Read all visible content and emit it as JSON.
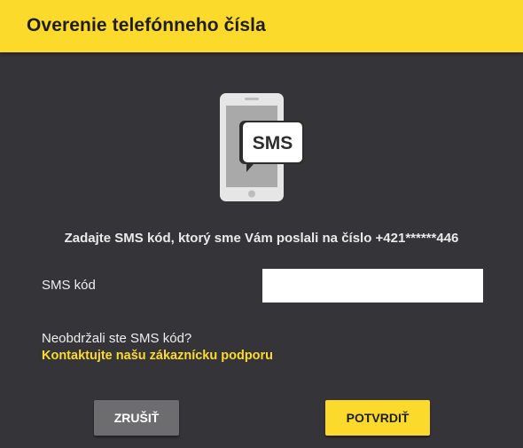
{
  "dialog": {
    "title": "Overenie telefónneho čísla",
    "illustration": {
      "icon": "phone-sms-icon",
      "bubble_text": "SMS"
    },
    "instruction": "Zadajte SMS kód, ktorý sme Vám poslali na číslo +421******446",
    "sms_field": {
      "label": "SMS kód",
      "value": "",
      "placeholder": ""
    },
    "help": {
      "question": "Neobdržali ste SMS kód?",
      "link_label": "Kontaktujte našu zákaznícku podporu"
    },
    "buttons": {
      "cancel_label": "ZRUŠIŤ",
      "confirm_label": "POTVRDIŤ"
    }
  },
  "colors": {
    "accent": "#fcda2c",
    "background": "#353438",
    "cancel_button": "#6d6d70"
  }
}
